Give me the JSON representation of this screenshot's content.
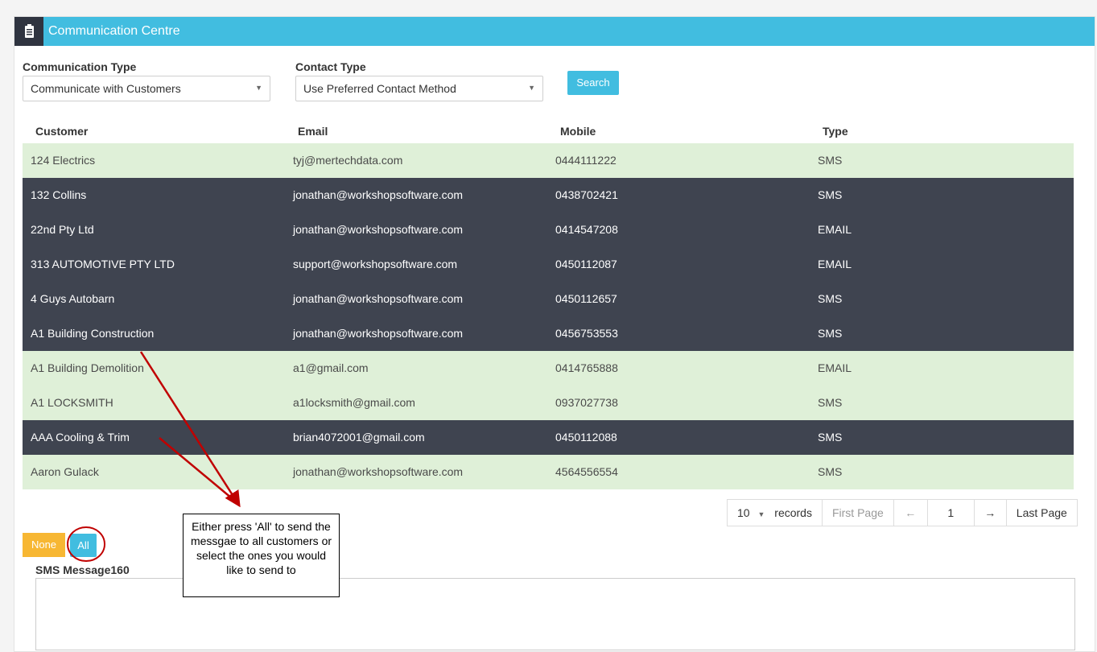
{
  "header": {
    "title": "Communication Centre",
    "icon": "clipboard-icon"
  },
  "filters": {
    "communication_type_label": "Communication Type",
    "communication_type_value": "Communicate with Customers",
    "contact_type_label": "Contact Type",
    "contact_type_value": "Use Preferred Contact Method",
    "search_label": "Search"
  },
  "table": {
    "headers": [
      "Customer",
      "Email",
      "Mobile",
      "Type"
    ],
    "rows": [
      {
        "customer": "124 Electrics",
        "email": "tyj@mertechdata.com",
        "mobile": "0444111222",
        "type": "SMS",
        "selected": false
      },
      {
        "customer": "132 Collins",
        "email": "jonathan@workshopsoftware.com",
        "mobile": "0438702421",
        "type": "SMS",
        "selected": true
      },
      {
        "customer": "22nd Pty Ltd",
        "email": "jonathan@workshopsoftware.com",
        "mobile": "0414547208",
        "type": "EMAIL",
        "selected": true
      },
      {
        "customer": "313 AUTOMOTIVE PTY LTD",
        "email": "support@workshopsoftware.com",
        "mobile": "0450112087",
        "type": "EMAIL",
        "selected": true
      },
      {
        "customer": "4 Guys Autobarn",
        "email": "jonathan@workshopsoftware.com",
        "mobile": "0450112657",
        "type": "SMS",
        "selected": true
      },
      {
        "customer": "A1 Building Construction",
        "email": "jonathan@workshopsoftware.com",
        "mobile": "0456753553",
        "type": "SMS",
        "selected": true
      },
      {
        "customer": "A1 Building Demolition",
        "email": "a1@gmail.com",
        "mobile": "0414765888",
        "type": "EMAIL",
        "selected": false
      },
      {
        "customer": "A1 LOCKSMITH",
        "email": "a1locksmith@gmail.com",
        "mobile": "0937027738",
        "type": "SMS",
        "selected": false
      },
      {
        "customer": "AAA Cooling & Trim",
        "email": "brian4072001@gmail.com",
        "mobile": "0450112088",
        "type": "SMS",
        "selected": true
      },
      {
        "customer": "Aaron Gulack",
        "email": "jonathan@workshopsoftware.com",
        "mobile": "4564556554",
        "type": "SMS",
        "selected": false
      }
    ]
  },
  "pagination": {
    "page_size": "10",
    "records_label": "records",
    "first_page": "First Page",
    "prev": "←",
    "current_page": "1",
    "next": "→",
    "last_page": "Last Page"
  },
  "selection": {
    "none_label": "None",
    "all_label": "All"
  },
  "sms": {
    "label": "SMS Message160",
    "value": ""
  },
  "annotation": {
    "text": "Either press 'All' to send the messgae to all customers or select the ones you would like to send to",
    "arrow_color": "#c00000"
  },
  "colors": {
    "accent": "#41bde0",
    "header_icon_bg": "#2f3440",
    "selected_row": "#3f4450",
    "unselected_row": "#dff0d8",
    "none_button": "#f7b733"
  }
}
